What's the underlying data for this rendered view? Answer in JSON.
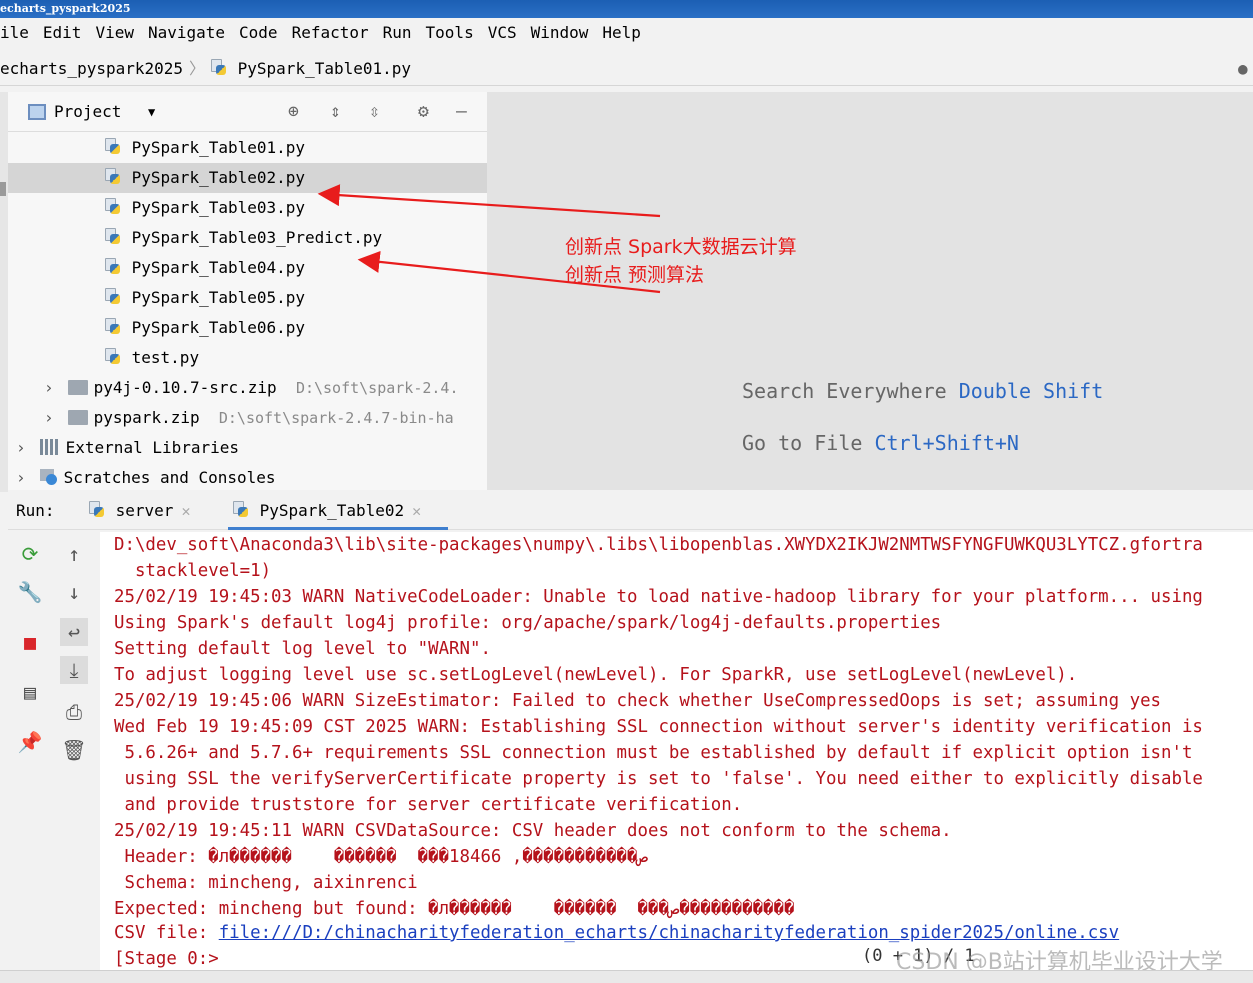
{
  "window": {
    "title": "echarts_pyspark2025"
  },
  "menu": [
    "ile",
    "Edit",
    "View",
    "Navigate",
    "Code",
    "Refactor",
    "Run",
    "Tools",
    "VCS",
    "Window",
    "Help"
  ],
  "breadcrumb": {
    "project": "echarts_pyspark2025",
    "file": "PySpark_Table01.py"
  },
  "project_panel": {
    "title": "Project",
    "files": [
      "PySpark_Table01.py",
      "PySpark_Table02.py",
      "PySpark_Table03.py",
      "PySpark_Table03_Predict.py",
      "PySpark_Table04.py",
      "PySpark_Table05.py",
      "PySpark_Table06.py",
      "test.py"
    ],
    "selected_index": 1,
    "zip1": {
      "name": "py4j-0.10.7-src.zip",
      "path": "D:\\soft\\spark-2.4."
    },
    "zip2": {
      "name": "pyspark.zip",
      "path": "D:\\soft\\spark-2.4.7-bin-ha"
    },
    "external": "External Libraries",
    "scratches": "Scratches and Consoles"
  },
  "editor_hints": {
    "search_label": "Search Everywhere",
    "search_key": "Double Shift",
    "goto_label": "Go to File",
    "goto_key": "Ctrl+Shift+N"
  },
  "annotation": {
    "line1": "创新点 Spark大数据云计算",
    "line2": "创新点 预测算法",
    "color": "#e81c1c"
  },
  "run": {
    "label": "Run:",
    "tab1": "server",
    "tab2": "PySpark_Table02"
  },
  "console_lines": [
    "D:\\dev_soft\\Anaconda3\\lib\\site-packages\\numpy\\.libs\\libopenblas.XWYDX2IKJW2NMTWSFYNGFUWKQU3LYTCZ.gfortra",
    "  stacklevel=1)",
    "25/02/19 19:45:03 WARN NativeCodeLoader: Unable to load native-hadoop library for your platform... using",
    "Using Spark's default log4j profile: org/apache/spark/log4j-defaults.properties",
    "Setting default log level to \"WARN\".",
    "To adjust logging level use sc.setLogLevel(newLevel). For SparkR, use setLogLevel(newLevel).",
    "25/02/19 19:45:06 WARN SizeEstimator: Failed to check whether UseCompressedOops is set; assuming yes",
    "Wed Feb 19 19:45:09 CST 2025 WARN: Establishing SSL connection without server's identity verification is",
    " 5.6.26+ and 5.7.6+ requirements SSL connection must be established by default if explicit option isn't",
    " using SSL the verifyServerCertificate property is set to 'false'. You need either to explicitly disable",
    " and provide truststore for server certificate verification.",
    "25/02/19 19:45:11 WARN CSVDataSource: CSV header does not conform to the schema.",
    " Header: �л������    ������  ���18466 ,�����������ص",
    " Schema: mincheng, aixinrenci",
    "Expected: mincheng but found: �л������    ������  ���ص�����������",
    "[Stage 0:>"
  ],
  "csv_file": {
    "label": "CSV file: ",
    "link": "file:///D:/chinacharityfederation_echarts/chinacharityfederation_spider2025/online.csv"
  },
  "progress": "(0 + 1) / 1",
  "watermark": "CSDN @B站计算机毕业设计大学"
}
